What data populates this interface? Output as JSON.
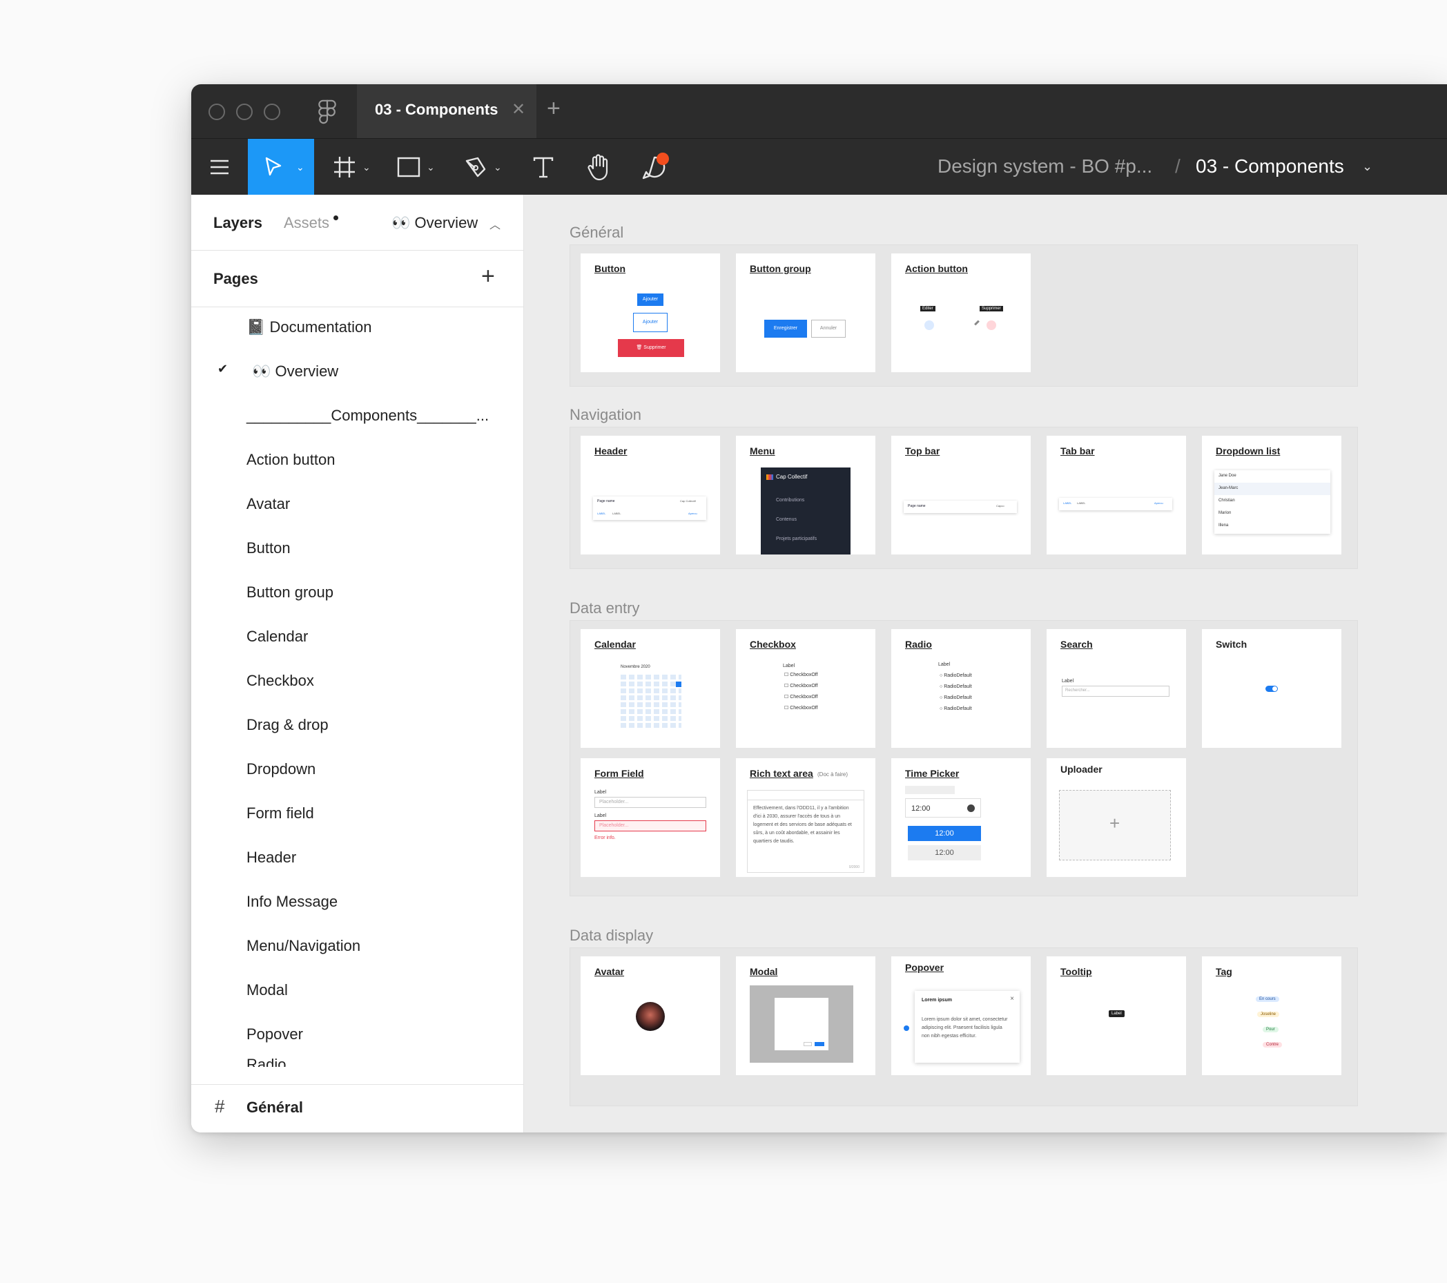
{
  "window": {
    "tab_title": "03 - Components",
    "close_glyph": "✕",
    "add_glyph": "+"
  },
  "toolbar": {
    "breadcrumb_file": "Design system - BO #p...",
    "breadcrumb_sep": "/",
    "breadcrumb_page": "03 - Components",
    "accent": "#1c98f7",
    "notification_color": "#f24e1e"
  },
  "sidebar": {
    "tab_layers": "Layers",
    "tab_assets": "Assets",
    "current_page": "👀 Overview",
    "pages_title": "Pages",
    "add_page": "+",
    "check_glyph": "✔",
    "pages": [
      "📓 Documentation",
      "👀 Overview",
      "__________Components_______...",
      "Action button",
      "Avatar",
      "Button",
      "Button group",
      "Calendar",
      "Checkbox",
      "Drag & drop",
      "Dropdown",
      "Form field",
      "Header",
      "Info Message",
      "Menu/Navigation",
      "Modal",
      "Popover",
      "Radio"
    ],
    "bottom_frame_icon": "#",
    "bottom_frame": "Général"
  },
  "canvas": {
    "sections": {
      "general": "Général",
      "navigation": "Navigation",
      "data_entry": "Data entry",
      "data_display": "Data display"
    },
    "general_cards": [
      "Button",
      "Button group",
      "Action button"
    ],
    "navigation_cards": [
      "Header",
      "Menu",
      "Top bar",
      "Tab bar",
      "Dropdown list"
    ],
    "entry_cards_row1": [
      "Calendar",
      "Checkbox",
      "Radio",
      "Search",
      "Switch"
    ],
    "entry_cards_row2": [
      "Form Field",
      "Rich text area",
      "Time Picker",
      "Uploader"
    ],
    "rich_text_note": "(Doc à faire)",
    "display_cards": [
      "Avatar",
      "Modal",
      "Popover",
      "Tooltip",
      "Tag"
    ],
    "button_card": {
      "primary": "Ajouter",
      "secondary": "Ajouter",
      "danger": "🗑 Supprimer"
    },
    "button_group_card": {
      "save": "Enregistrer",
      "cancel": "Annuler"
    },
    "action_button_card": {
      "edit_tip": "Editer",
      "delete_tip": "Supprimer"
    },
    "header_card": {
      "page_name": "Page name",
      "tab1": "LABEL",
      "tab2": "LABEL",
      "right": "Cap Collectif",
      "action": "Apercu"
    },
    "menu_card": {
      "brand": "Cap Collectif",
      "items": [
        "Contributions",
        "Contenus",
        "Projets participatifs"
      ]
    },
    "topbar_card": {
      "page_name": "Page name",
      "right": "Capco"
    },
    "tabbar_card": {
      "tab1": "LABEL",
      "tab2": "LABEL",
      "action": "Apercu"
    },
    "dropdown_card": {
      "items": [
        "Jane Doe",
        "Jean-Marc",
        "Christian",
        "Marion",
        "Illena"
      ]
    },
    "calendar_card": {
      "month": "Novembre 2020"
    },
    "checkbox_card": {
      "label": "Label",
      "items": [
        "CheckboxOff",
        "CheckboxOff",
        "CheckboxOff",
        "CheckboxOff"
      ]
    },
    "radio_card": {
      "label": "Label",
      "items": [
        "RadioDefault",
        "RadioDefault",
        "RadioDefault",
        "RadioDefault"
      ]
    },
    "search_card": {
      "label": "Label",
      "placeholder": "Rechercher..."
    },
    "formfield_card": {
      "label1": "Label",
      "placeholder1": "Placeholder...",
      "label2": "Label",
      "placeholder2": "Placeholder...",
      "error": "Error info."
    },
    "richtext_card": {
      "text": "Effectivement, dans l'ODD11, il y a l'ambition d'ici à 2030, assurer l'accès de tous à un logement et des services de base adéquats et sûrs, à un coût abordable, et assainir les quartiers de taudis.",
      "count": "0/2000"
    },
    "timepicker_card": {
      "value": "12:00",
      "opt1": "12:00",
      "opt2": "12:00"
    },
    "uploader_card": {
      "plus": "+"
    },
    "popover_card": {
      "title": "Lorem ipsum",
      "text": "Lorem ipsum dolor sit amet, consectetur adipiscing elit. Praesent facilisis ligula non nibh egestas efficitur."
    },
    "tooltip_card": {
      "label": "Label"
    },
    "tag_card": {
      "tags": [
        "En cours",
        "Joseline",
        "Pour",
        "Contre"
      ]
    }
  }
}
